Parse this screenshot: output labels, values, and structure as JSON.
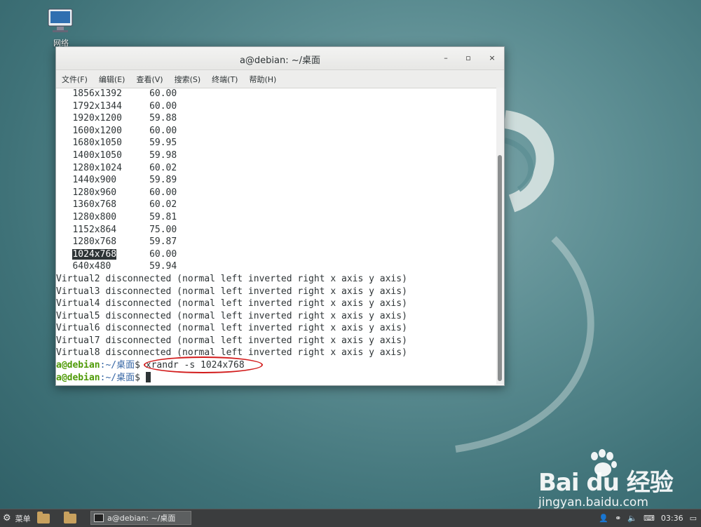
{
  "desktop": {
    "icon_label": "网络"
  },
  "window": {
    "title": "a@debian: ~/桌面",
    "controls": {
      "minimize": "–",
      "maximize": "▫",
      "close": "×"
    },
    "menu": [
      "文件(F)",
      "编辑(E)",
      "查看(V)",
      "搜索(S)",
      "终端(T)",
      "帮助(H)"
    ]
  },
  "terminal": {
    "modes": [
      [
        "1856x1392",
        "60.00"
      ],
      [
        "1792x1344",
        "60.00"
      ],
      [
        "1920x1200",
        "59.88"
      ],
      [
        "1600x1200",
        "60.00"
      ],
      [
        "1680x1050",
        "59.95"
      ],
      [
        "1400x1050",
        "59.98"
      ],
      [
        "1280x1024",
        "60.02"
      ],
      [
        "1440x900",
        "59.89"
      ],
      [
        "1280x960",
        "60.00"
      ],
      [
        "1360x768",
        "60.02"
      ],
      [
        "1280x800",
        "59.81"
      ],
      [
        "1152x864",
        "75.00"
      ],
      [
        "1280x768",
        "59.87"
      ],
      [
        "1024x768",
        "60.00"
      ],
      [
        "640x480",
        "59.94"
      ]
    ],
    "highlighted_mode": "1024x768",
    "outputs": [
      "Virtual2 disconnected (normal left inverted right x axis y axis)",
      "Virtual3 disconnected (normal left inverted right x axis y axis)",
      "Virtual4 disconnected (normal left inverted right x axis y axis)",
      "Virtual5 disconnected (normal left inverted right x axis y axis)",
      "Virtual6 disconnected (normal left inverted right x axis y axis)",
      "Virtual7 disconnected (normal left inverted right x axis y axis)",
      "Virtual8 disconnected (normal left inverted right x axis y axis)"
    ],
    "prompt_user": "a@debian",
    "prompt_path": ":~/桌面",
    "prompt_symbol": "$",
    "command": " xrandr -s 1024x768"
  },
  "watermark": {
    "brand": "Bai du 经验",
    "url": "jingyan.baidu.com"
  },
  "taskbar": {
    "menu_label": "菜单",
    "task_label": "a@debian: ~/桌面",
    "clock": "03:36"
  }
}
